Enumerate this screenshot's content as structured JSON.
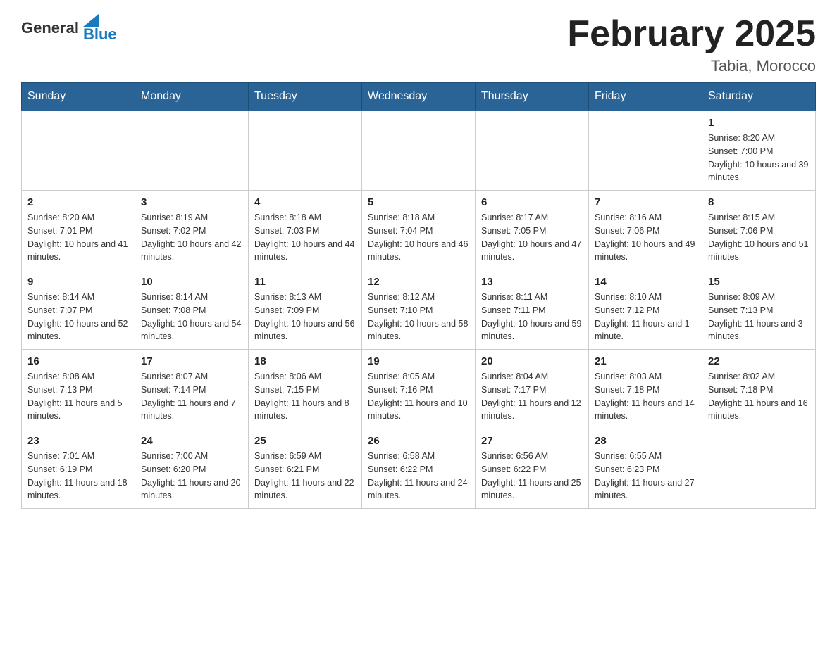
{
  "header": {
    "logo_general": "General",
    "logo_blue": "Blue",
    "month_title": "February 2025",
    "location": "Tabia, Morocco"
  },
  "days_of_week": [
    "Sunday",
    "Monday",
    "Tuesday",
    "Wednesday",
    "Thursday",
    "Friday",
    "Saturday"
  ],
  "weeks": [
    {
      "days": [
        {
          "num": "",
          "info": ""
        },
        {
          "num": "",
          "info": ""
        },
        {
          "num": "",
          "info": ""
        },
        {
          "num": "",
          "info": ""
        },
        {
          "num": "",
          "info": ""
        },
        {
          "num": "",
          "info": ""
        },
        {
          "num": "1",
          "info": "Sunrise: 8:20 AM\nSunset: 7:00 PM\nDaylight: 10 hours and 39 minutes."
        }
      ]
    },
    {
      "days": [
        {
          "num": "2",
          "info": "Sunrise: 8:20 AM\nSunset: 7:01 PM\nDaylight: 10 hours and 41 minutes."
        },
        {
          "num": "3",
          "info": "Sunrise: 8:19 AM\nSunset: 7:02 PM\nDaylight: 10 hours and 42 minutes."
        },
        {
          "num": "4",
          "info": "Sunrise: 8:18 AM\nSunset: 7:03 PM\nDaylight: 10 hours and 44 minutes."
        },
        {
          "num": "5",
          "info": "Sunrise: 8:18 AM\nSunset: 7:04 PM\nDaylight: 10 hours and 46 minutes."
        },
        {
          "num": "6",
          "info": "Sunrise: 8:17 AM\nSunset: 7:05 PM\nDaylight: 10 hours and 47 minutes."
        },
        {
          "num": "7",
          "info": "Sunrise: 8:16 AM\nSunset: 7:06 PM\nDaylight: 10 hours and 49 minutes."
        },
        {
          "num": "8",
          "info": "Sunrise: 8:15 AM\nSunset: 7:06 PM\nDaylight: 10 hours and 51 minutes."
        }
      ]
    },
    {
      "days": [
        {
          "num": "9",
          "info": "Sunrise: 8:14 AM\nSunset: 7:07 PM\nDaylight: 10 hours and 52 minutes."
        },
        {
          "num": "10",
          "info": "Sunrise: 8:14 AM\nSunset: 7:08 PM\nDaylight: 10 hours and 54 minutes."
        },
        {
          "num": "11",
          "info": "Sunrise: 8:13 AM\nSunset: 7:09 PM\nDaylight: 10 hours and 56 minutes."
        },
        {
          "num": "12",
          "info": "Sunrise: 8:12 AM\nSunset: 7:10 PM\nDaylight: 10 hours and 58 minutes."
        },
        {
          "num": "13",
          "info": "Sunrise: 8:11 AM\nSunset: 7:11 PM\nDaylight: 10 hours and 59 minutes."
        },
        {
          "num": "14",
          "info": "Sunrise: 8:10 AM\nSunset: 7:12 PM\nDaylight: 11 hours and 1 minute."
        },
        {
          "num": "15",
          "info": "Sunrise: 8:09 AM\nSunset: 7:13 PM\nDaylight: 11 hours and 3 minutes."
        }
      ]
    },
    {
      "days": [
        {
          "num": "16",
          "info": "Sunrise: 8:08 AM\nSunset: 7:13 PM\nDaylight: 11 hours and 5 minutes."
        },
        {
          "num": "17",
          "info": "Sunrise: 8:07 AM\nSunset: 7:14 PM\nDaylight: 11 hours and 7 minutes."
        },
        {
          "num": "18",
          "info": "Sunrise: 8:06 AM\nSunset: 7:15 PM\nDaylight: 11 hours and 8 minutes."
        },
        {
          "num": "19",
          "info": "Sunrise: 8:05 AM\nSunset: 7:16 PM\nDaylight: 11 hours and 10 minutes."
        },
        {
          "num": "20",
          "info": "Sunrise: 8:04 AM\nSunset: 7:17 PM\nDaylight: 11 hours and 12 minutes."
        },
        {
          "num": "21",
          "info": "Sunrise: 8:03 AM\nSunset: 7:18 PM\nDaylight: 11 hours and 14 minutes."
        },
        {
          "num": "22",
          "info": "Sunrise: 8:02 AM\nSunset: 7:18 PM\nDaylight: 11 hours and 16 minutes."
        }
      ]
    },
    {
      "days": [
        {
          "num": "23",
          "info": "Sunrise: 7:01 AM\nSunset: 6:19 PM\nDaylight: 11 hours and 18 minutes."
        },
        {
          "num": "24",
          "info": "Sunrise: 7:00 AM\nSunset: 6:20 PM\nDaylight: 11 hours and 20 minutes."
        },
        {
          "num": "25",
          "info": "Sunrise: 6:59 AM\nSunset: 6:21 PM\nDaylight: 11 hours and 22 minutes."
        },
        {
          "num": "26",
          "info": "Sunrise: 6:58 AM\nSunset: 6:22 PM\nDaylight: 11 hours and 24 minutes."
        },
        {
          "num": "27",
          "info": "Sunrise: 6:56 AM\nSunset: 6:22 PM\nDaylight: 11 hours and 25 minutes."
        },
        {
          "num": "28",
          "info": "Sunrise: 6:55 AM\nSunset: 6:23 PM\nDaylight: 11 hours and 27 minutes."
        },
        {
          "num": "",
          "info": ""
        }
      ]
    }
  ]
}
